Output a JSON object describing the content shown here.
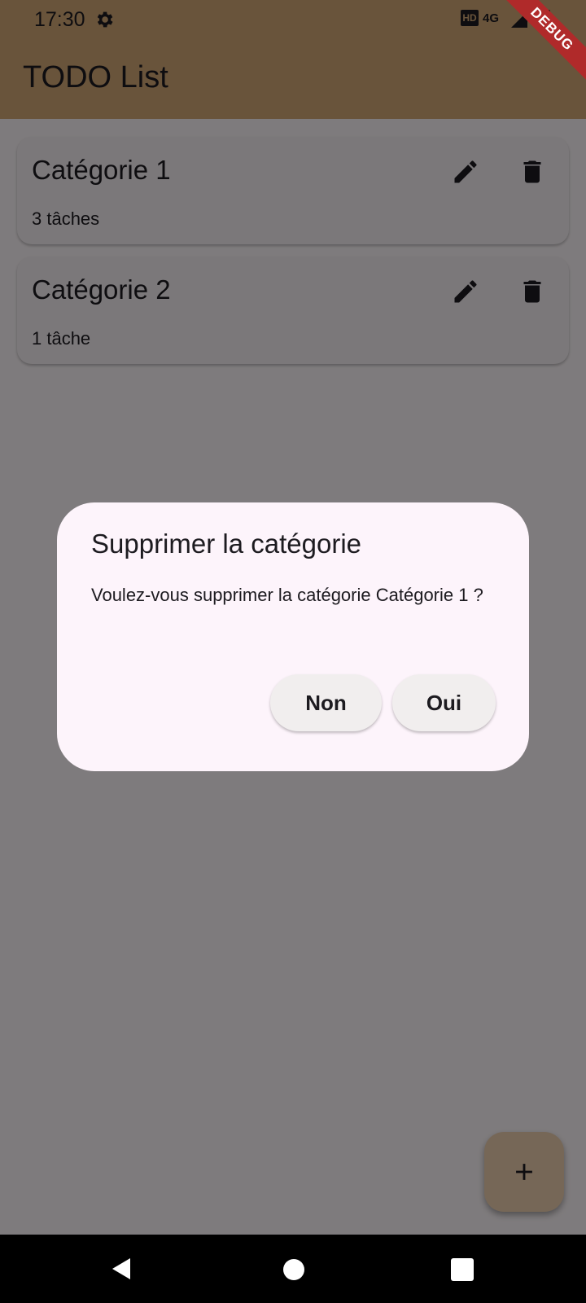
{
  "status_bar": {
    "time": "17:30",
    "settings_icon": "gear-icon",
    "hd_badge": "HD",
    "network": "4G"
  },
  "debug_banner": "DEBUG",
  "app_bar": {
    "title": "TODO List"
  },
  "categories": [
    {
      "title": "Catégorie 1",
      "subtitle": "3 tâches",
      "edit_icon": "pencil-icon",
      "delete_icon": "trash-icon"
    },
    {
      "title": "Catégorie 2",
      "subtitle": "1 tâche",
      "edit_icon": "pencil-icon",
      "delete_icon": "trash-icon"
    }
  ],
  "dialog": {
    "title": "Supprimer la catégorie",
    "message": "Voulez-vous supprimer la catégorie Catégorie 1 ?",
    "cancel_label": "Non",
    "confirm_label": "Oui"
  },
  "fab": {
    "icon": "plus-icon"
  },
  "colors": {
    "app_bar": "#d2a877",
    "fab": "#eccfae",
    "dialog_bg": "#fdf4fb",
    "debug_ribbon": "#b02a2a"
  }
}
